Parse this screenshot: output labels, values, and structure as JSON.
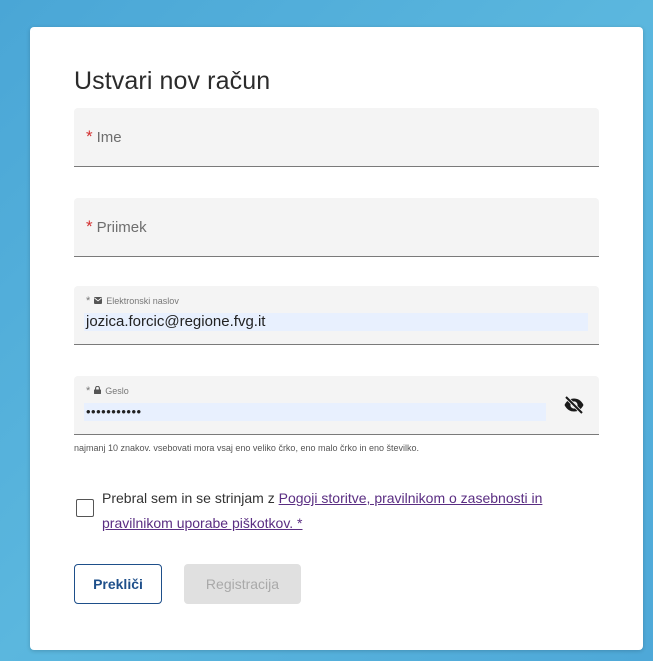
{
  "form": {
    "title": "Ustvari nov račun",
    "required_mark": "*",
    "first_name": {
      "label": "Ime",
      "value": ""
    },
    "last_name": {
      "label": "Priimek",
      "value": ""
    },
    "email": {
      "label": "Elektronski naslov",
      "value": "jozica.forcic@regione.fvg.it",
      "icon": "envelope-icon"
    },
    "password": {
      "label": "Geslo",
      "value": "•••••••••••",
      "icon": "lock-icon",
      "toggle_icon": "eye-off-icon"
    },
    "password_hint": "najmanj 10 znakov. vsebovati mora vsaj eno veliko črko, eno malo črko in eno številko.",
    "consent": {
      "prefix": "Prebral sem in se strinjam z ",
      "link": "Pogoji storitve, pravilnikom o zasebnosti in pravilnikom uporabe piškotkov. *",
      "checked": false
    },
    "buttons": {
      "cancel": "Prekliči",
      "register": "Registracija"
    }
  }
}
